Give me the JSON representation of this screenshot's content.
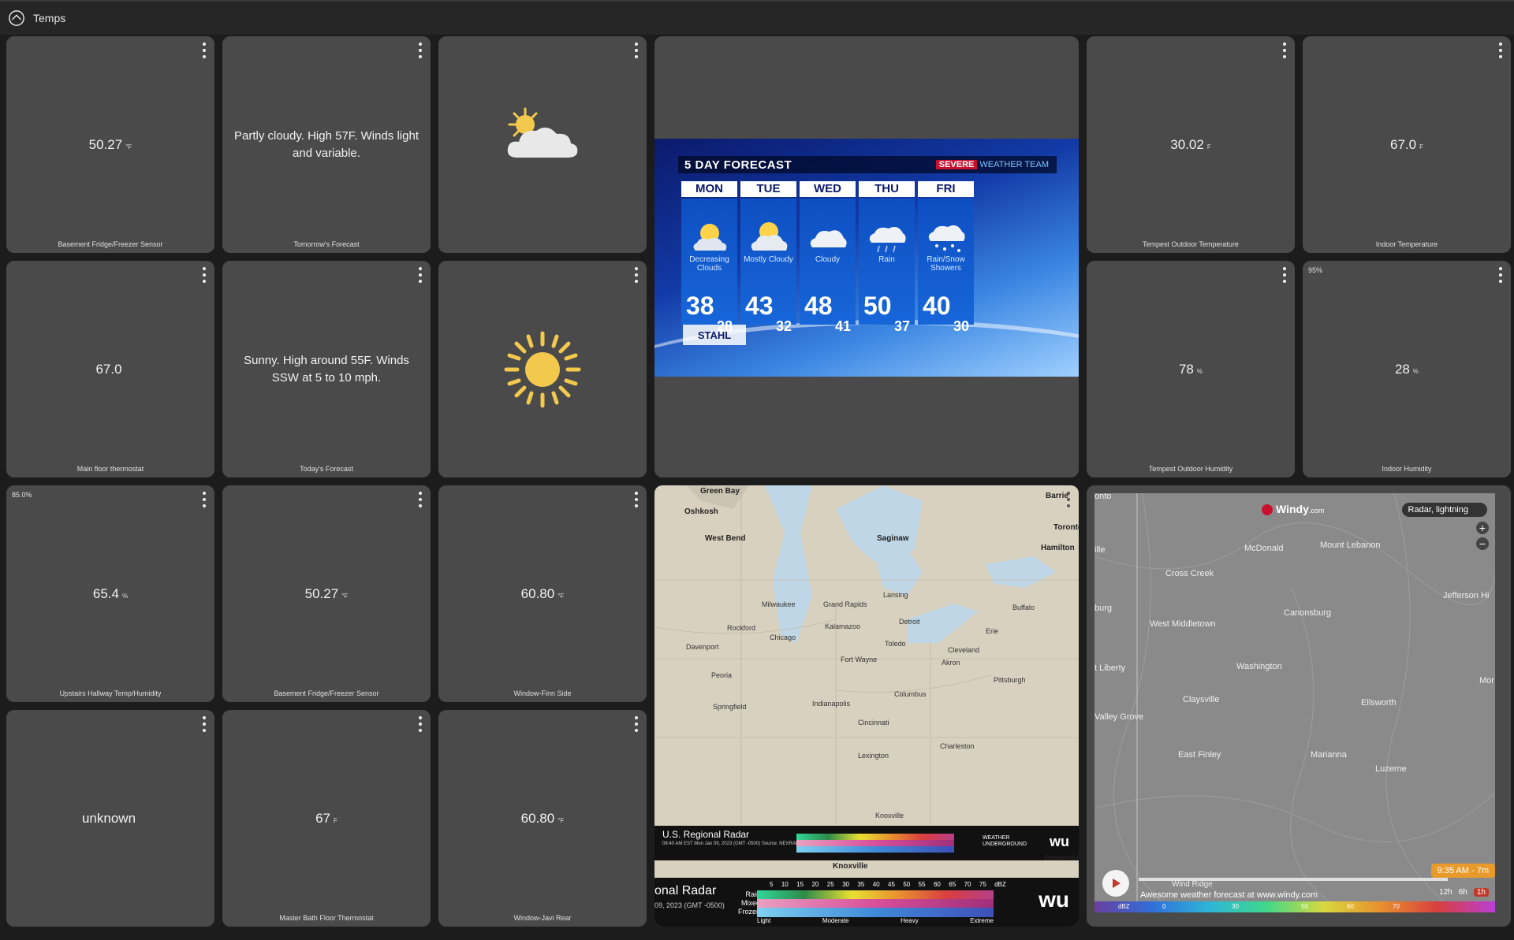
{
  "header": {
    "title": "Temps"
  },
  "tiles": [
    {
      "value": "50.27",
      "unit": "°F",
      "label": "Basement Fridge/Freezer Sensor"
    },
    {
      "text": "Partly cloudy. High 57F. Winds light and variable.",
      "label": "Tomorrow's Forecast"
    },
    {
      "icon": "partly-cloudy-icon"
    },
    {
      "value": "30.02",
      "unit": "F",
      "label": "Tempest Outdoor Temperature"
    },
    {
      "value": "67.0",
      "unit": "F",
      "label": "Indoor Temperature"
    },
    {
      "value": "67.0",
      "unit": "",
      "label": "Main floor thermostat"
    },
    {
      "text": "Sunny. High around 55F. Winds SSW at 5 to 10 mph.",
      "label": "Today's Forecast"
    },
    {
      "icon": "sun-icon"
    },
    {
      "value": "78",
      "unit": "%",
      "label": "Tempest Outdoor Humidity"
    },
    {
      "corner": "95%",
      "value": "28",
      "unit": "%",
      "label": "Indoor Humidity"
    },
    {
      "corner": "85.0%",
      "value": "65.4",
      "unit": "%",
      "label": "Upstairs Hallway Temp/Humidity"
    },
    {
      "value": "50.27",
      "unit": "°F",
      "label": "Basement Fridge/Freezer Sensor"
    },
    {
      "value": "60.80",
      "unit": "°F",
      "label": "Window-Finn Side"
    },
    {
      "value": "unknown",
      "unit": "",
      "label": ""
    },
    {
      "value": "67",
      "unit": "F",
      "label": "Master Bath Floor Thermostat"
    },
    {
      "value": "60.80",
      "unit": "°F",
      "label": "Window-Javi Rear"
    }
  ],
  "forecast": {
    "title": "5 DAY FORECAST",
    "team_severe": "SEVERE",
    "team_rest": "WEATHER TEAM",
    "sponsor": "STAHL",
    "days": [
      {
        "name": "MON",
        "cond": "Decreasing Clouds",
        "hi": "38",
        "lo": "28"
      },
      {
        "name": "TUE",
        "cond": "Mostly Cloudy",
        "hi": "43",
        "lo": "32"
      },
      {
        "name": "WED",
        "cond": "Cloudy",
        "hi": "48",
        "lo": "41"
      },
      {
        "name": "THU",
        "cond": "Rain",
        "hi": "50",
        "lo": "37"
      },
      {
        "name": "FRI",
        "cond": "Rain/Snow Showers",
        "hi": "40",
        "lo": "30"
      }
    ]
  },
  "radar": {
    "title": "U.S. Regional Radar",
    "subtitle": "08:40 AM EST Mon Jan 09, 2023 (GMT -0500) Source: NEXRAD",
    "title_crop": "onal Radar",
    "subtitle_crop": "09, 2023 (GMT -0500)",
    "rain": "Rain",
    "mixed": "Mixed",
    "frozen": "Frozen",
    "levels": [
      "Light",
      "Moderate",
      "Heavy",
      "Extreme"
    ],
    "dbz": [
      "5",
      "10",
      "15",
      "20",
      "25",
      "30",
      "35",
      "40",
      "45",
      "50",
      "55",
      "60",
      "65",
      "70",
      "75",
      "dBZ"
    ],
    "brand_line1": "WEATHER",
    "brand_line2": "UNDERGROUND",
    "cities": [
      "Green Bay",
      "Oshkosh",
      "West Bend",
      "Saginaw",
      "Barrie",
      "Toronto",
      "Hamilton",
      "Milwaukee",
      "Grand Rapids",
      "Chicago",
      "Detroit",
      "Cleveland",
      "Toledo",
      "Fort Wayne",
      "Indianapolis",
      "Columbus",
      "Pittsburgh",
      "Cincinnati",
      "Charleston",
      "Lexington",
      "Knoxville",
      "Buffalo",
      "Erie",
      "Akron",
      "Springfield",
      "Peoria",
      "Rockford",
      "Davenport",
      "Kalamazoo",
      "Lansing"
    ],
    "knoxville_label": "Knoxville",
    "greensboro_label": "Greensbo"
  },
  "windy": {
    "brand": "Windy",
    "brand_suffix": ".com",
    "overlay": "Radar, lightning",
    "time": "9:35 AM - 7m",
    "hours": [
      "12h",
      "6h",
      "1h"
    ],
    "promo": "Awesome weather forecast at www.windy.com",
    "ridge": "Wind Ridge",
    "scale": [
      "dBZ",
      "0",
      "30",
      "50",
      "60",
      "70"
    ],
    "places": [
      "McDonald",
      "Mount Lebanon",
      "Cross Creek",
      "Jefferson Hi",
      "West Middletown",
      "Canonsburg",
      "Washington",
      "t Liberty",
      "Claysville",
      "Ellsworth",
      "Valley Grove",
      "East Finley",
      "Marianna",
      "Luzerne",
      "burg",
      "ille",
      "onto",
      "Mor"
    ]
  }
}
